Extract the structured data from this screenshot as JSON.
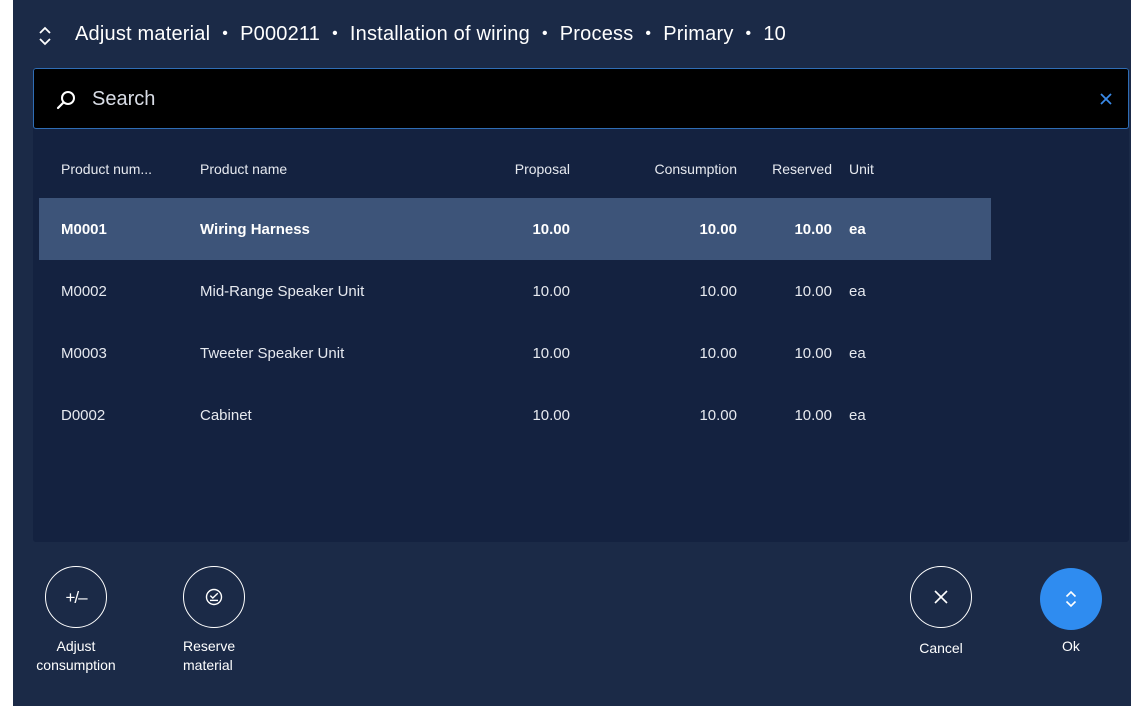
{
  "header": {
    "segments": [
      "Adjust material",
      "P000211",
      "Installation of wiring",
      "Process",
      "Primary",
      "10"
    ],
    "separator": "•",
    "icon": "chevron-up-down-icon"
  },
  "search": {
    "placeholder": "Search",
    "value": "",
    "icon": "search-icon",
    "clear_icon": "close-icon"
  },
  "table": {
    "columns": {
      "product_number": "Product num...",
      "product_name": "Product name",
      "proposal": "Proposal",
      "consumption": "Consumption",
      "reserved": "Reserved",
      "unit": "Unit"
    },
    "rows": [
      {
        "product_number": "M0001",
        "product_name": "Wiring Harness",
        "proposal": "10.00",
        "consumption": "10.00",
        "reserved": "10.00",
        "unit": "ea",
        "selected": true
      },
      {
        "product_number": "M0002",
        "product_name": "Mid-Range Speaker Unit",
        "proposal": "10.00",
        "consumption": "10.00",
        "reserved": "10.00",
        "unit": "ea",
        "selected": false
      },
      {
        "product_number": "M0003",
        "product_name": "Tweeter Speaker Unit",
        "proposal": "10.00",
        "consumption": "10.00",
        "reserved": "10.00",
        "unit": "ea",
        "selected": false
      },
      {
        "product_number": "D0002",
        "product_name": "Cabinet",
        "proposal": "10.00",
        "consumption": "10.00",
        "reserved": "10.00",
        "unit": "ea",
        "selected": false
      }
    ]
  },
  "actions": {
    "adjust_consumption": {
      "line1": "Adjust",
      "line2": "consumption",
      "glyph": "+/–",
      "icon": "plus-minus-icon"
    },
    "reserve_material": {
      "line1": "Reserve",
      "line2": "material",
      "icon": "reserve-icon"
    },
    "cancel": {
      "label": "Cancel",
      "icon": "close-icon"
    },
    "ok": {
      "label": "Ok",
      "icon": "chevron-up-down-icon"
    }
  },
  "colors": {
    "background": "#1b2a47",
    "panel": "#142240",
    "selected_row": "#3d5479",
    "search_border": "#2f6db5",
    "accent": "#2f8cf0"
  }
}
